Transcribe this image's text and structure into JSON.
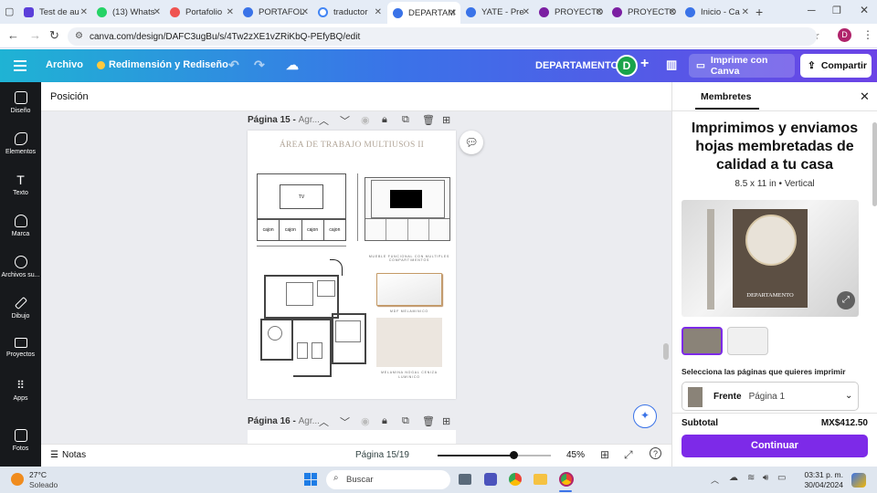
{
  "browser": {
    "tabs": [
      {
        "label": "Test de au",
        "color": "#5b3fd9"
      },
      {
        "label": "(13) Whats",
        "color": "#25d366"
      },
      {
        "label": "Portafolio",
        "color": "#ef5350"
      },
      {
        "label": "PORTAFOL",
        "color": "#3a73e8"
      },
      {
        "label": "traductor",
        "color": "#4285f4"
      },
      {
        "label": "DEPARTAM",
        "color": "#3a73e8"
      },
      {
        "label": "YATE - Pre",
        "color": "#3a73e8"
      },
      {
        "label": "PROYECTO",
        "color": "#7b1fa2"
      },
      {
        "label": "PROYECTO",
        "color": "#7b1fa2"
      },
      {
        "label": "Inicio - Ca",
        "color": "#3a73e8"
      }
    ],
    "url": "canva.com/design/DAFC3ugBu/s/4Tw2zXE1vZRiKbQ-PEfyBQ/edit",
    "profile_initial": "D"
  },
  "header": {
    "file_menu": "Archivo",
    "promo": "Redimensión y Rediseño",
    "doc_title": "DEPARTAMENTO",
    "avatar": "D",
    "print_btn": "Imprime con Canva",
    "share_btn": "Compartir"
  },
  "rail": [
    {
      "label": "Diseño"
    },
    {
      "label": "Elementos"
    },
    {
      "label": "Texto"
    },
    {
      "label": "Marca"
    },
    {
      "label": "Archivos su..."
    },
    {
      "label": "Dibujo"
    },
    {
      "label": "Proyectos"
    },
    {
      "label": "Apps"
    },
    {
      "label": "Fotos"
    }
  ],
  "editor": {
    "position_label": "Posición",
    "page15_label": "Página 15 -",
    "page15_sub": "Agr...",
    "page16_label": "Página 16 -",
    "page16_sub": "Agr...",
    "page_content": {
      "title": "ÁREA DE TRABAJO MULTIUSOS II",
      "tv": "TV",
      "cajon": [
        "cajon",
        "cajon",
        "cajon",
        "cajon"
      ],
      "caption1": "MUEBLE FUNCIONAL CON MULTIPLES COMPARTIMENTOS",
      "caption2": "MDF MELAMINICO",
      "caption3": "MELAMINA NOGAL CENIZA LUMINICO"
    }
  },
  "bottombar": {
    "notes": "Notas",
    "page_indicator": "Página 15/19",
    "zoom": "45%",
    "zoom_fraction": 0.45
  },
  "panel": {
    "tab": "Membretes",
    "heading": "Imprimimos y enviamos hojas membretadas de calidad a tu casa",
    "spec": "8.5 x 11 in • Vertical",
    "preview_text": "DEPARTAMENTO",
    "select_label": "Selecciona las páginas que quieres imprimir",
    "side": "Frente",
    "page_select": "Página 1",
    "subtotal_label": "Subtotal",
    "subtotal_value": "MX$412.50",
    "continue_btn": "Continuar"
  },
  "taskbar": {
    "temp": "27°C",
    "weather": "Soleado",
    "search": "Buscar",
    "time": "03:31 p. m.",
    "date": "30/04/2024"
  },
  "colors": {
    "accent": "#7d2ae8",
    "header_start": "#1fb3d4",
    "header_end": "#6b43e6",
    "rail": "#17191c"
  }
}
